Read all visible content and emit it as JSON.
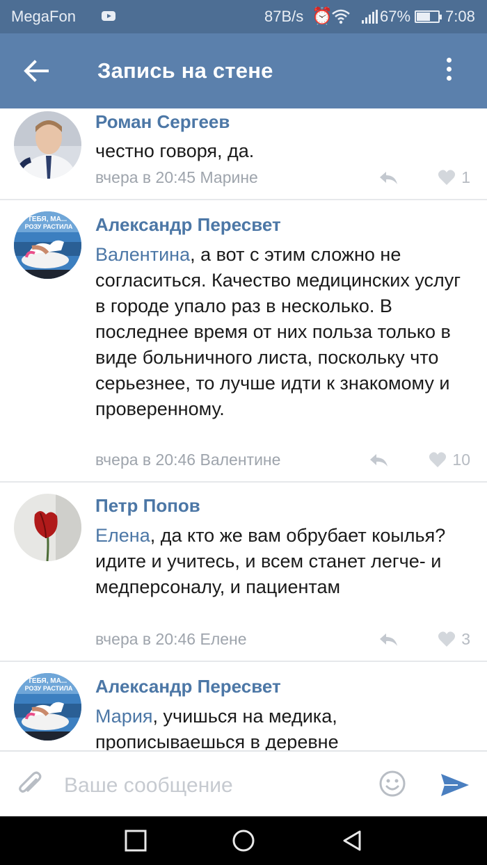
{
  "status_bar": {
    "carrier": "MegaFon",
    "speed": "87B/s",
    "battery": "67%",
    "time": "7:08"
  },
  "app_bar": {
    "title": "Запись на стене",
    "icons": [
      "back-arrow-icon",
      "more-vertical-icon"
    ]
  },
  "comments": [
    {
      "author": "Роман Сергеев",
      "mention": "",
      "text": "честно говоря, да.",
      "time": "вчера в 20:45",
      "reply_to": "Марине",
      "likes": "1"
    },
    {
      "author": "Александр Пересвет",
      "mention": "Валентина",
      "text": ", а вот с этим сложно не согласиться. Качество медицинских услуг в городе упало раз в несколько. В последнее время от них польза только в виде больничного листа, поскольку что серьезнее, то лучше идти к знакомому и проверенному.",
      "time": "вчера в 20:46",
      "reply_to": "Валентине",
      "likes": "10"
    },
    {
      "author": "Петр Попов",
      "mention": "Елена",
      "text": ", да кто же вам обрубает коылья? идите и учитесь, и всем станет легче- и медперсоналу, и пациентам",
      "time": "вчера в 20:46",
      "reply_to": "Елене",
      "likes": "3"
    },
    {
      "author": "Александр Пересвет",
      "mention": "Мария",
      "text": ", учишься на медика, прописываешься в деревне",
      "time": "",
      "reply_to": "",
      "likes": ""
    }
  ],
  "input": {
    "placeholder": "Ваше сообщение"
  },
  "colors": {
    "status_bar": "#4d6e94",
    "app_bar": "#5b80ac",
    "link": "#4c77a6",
    "meta": "#9ea4ac"
  }
}
